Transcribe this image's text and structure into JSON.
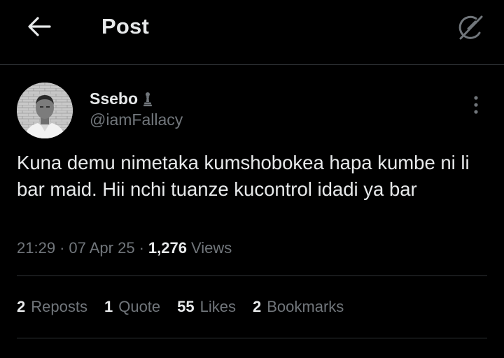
{
  "header": {
    "title": "Post",
    "back_icon": "arrow-left-icon",
    "grok_icon": "grok-slash-circle-icon"
  },
  "author": {
    "display_name": "Ssebo",
    "badge_icon": "chess-pawn-icon",
    "badge_glyph": "♟",
    "handle": "@iamFallacy",
    "more_icon": "more-vertical-icon"
  },
  "tweet": {
    "text": "Kuna demu nimetaka kumshobokea hapa kumbe ni li bar maid. Hii nchi tuanze kucontrol idadi ya bar"
  },
  "meta": {
    "time": "21:29",
    "separator": "·",
    "date": "07 Apr 25",
    "views_count": "1,276",
    "views_label": "Views"
  },
  "stats": [
    {
      "count": "2",
      "label": "Reposts"
    },
    {
      "count": "1",
      "label": "Quote"
    },
    {
      "count": "55",
      "label": "Likes"
    },
    {
      "count": "2",
      "label": "Bookmarks"
    }
  ],
  "colors": {
    "background": "#000000",
    "primary_text": "#e7e9ea",
    "secondary_text": "#71767b",
    "divider": "#2f3336"
  }
}
